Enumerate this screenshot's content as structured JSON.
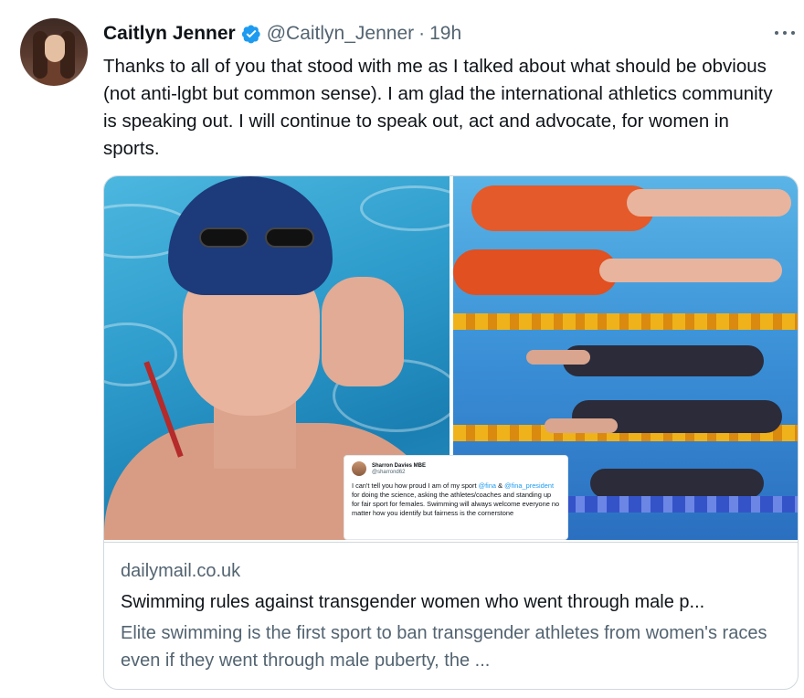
{
  "author": {
    "name": "Caitlyn Jenner",
    "handle": "@Caitlyn_Jenner",
    "separator": "·",
    "time": "19h",
    "verified_icon": "verified-badge-icon",
    "verified_color": "#1d9bf0"
  },
  "tweet": {
    "text": "Thanks to all of you that stood with me as I talked about what should be obvious (not anti-lgbt but common sense). I am glad the international athletics community is speaking out. I will continue to speak out, act and advocate, for women in sports."
  },
  "more_icon": "more-options-icon",
  "embedded_tweet": {
    "name": "Sharron Davies MBE",
    "handle": "@sharrond62",
    "text_1": "I can't tell you how proud I am of my sport ",
    "mention_1": "@fina",
    "text_2": " & ",
    "mention_2": "@fina_president",
    "text_3": " for doing the science, asking the athletes/coaches and standing up for fair sport for females. Swimming will always welcome everyone no matter how you identify but fairness is the cornerstone"
  },
  "card": {
    "domain": "dailymail.co.uk",
    "title": "Swimming rules against transgender women who went through male p...",
    "description": "Elite swimming is the first sport to ban transgender athletes from women's races even if they went through male puberty, the ..."
  },
  "colors": {
    "text_primary": "#0f1419",
    "text_secondary": "#536471",
    "border": "#cfd9de",
    "link": "#1d9bf0"
  }
}
